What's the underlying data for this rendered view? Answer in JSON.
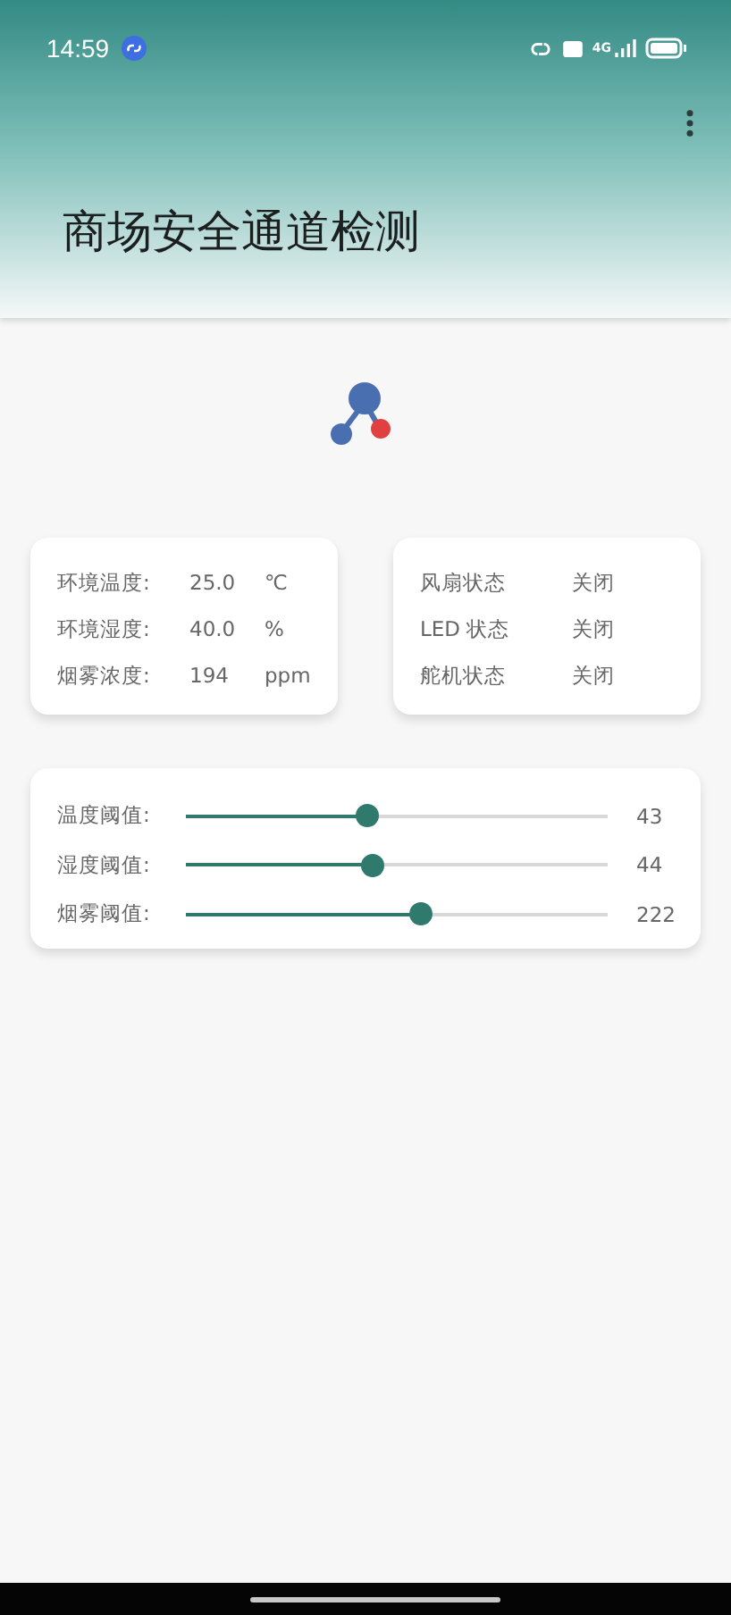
{
  "status_bar": {
    "time": "14:59",
    "network": "4G"
  },
  "app_bar": {
    "title": "商场安全通道检测"
  },
  "sensors": [
    {
      "label": "环境温度:",
      "value": "25.0",
      "unit": "℃"
    },
    {
      "label": "环境湿度:",
      "value": "40.0",
      "unit": "%"
    },
    {
      "label": "烟雾浓度:",
      "value": "194",
      "unit": "ppm"
    }
  ],
  "devices": [
    {
      "label": "风扇状态",
      "state": "关闭"
    },
    {
      "label": "LED 状态",
      "state": "关闭"
    },
    {
      "label": "舵机状态",
      "state": "关闭"
    }
  ],
  "thresholds": [
    {
      "label": "温度阈值:",
      "level": 0.43,
      "reading": "43"
    },
    {
      "label": "湿度阈值:",
      "level": 0.44,
      "reading": "44"
    },
    {
      "label": "烟雾阈值:",
      "level": 0.555,
      "reading": "222"
    }
  ]
}
